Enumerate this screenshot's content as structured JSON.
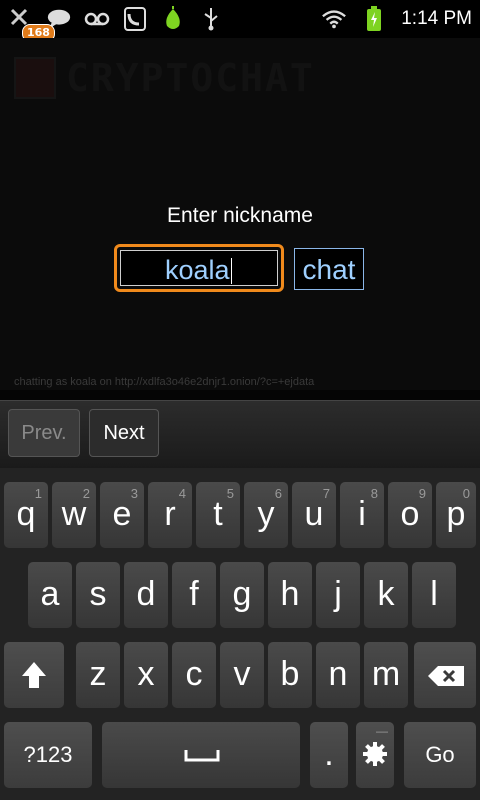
{
  "status_bar": {
    "notification_count": "168",
    "time": "1:14 PM",
    "icons": [
      "missed-call-icon",
      "chat-bubble-icon",
      "voicemail-icon",
      "sip-phone-icon",
      "tor-onion-icon",
      "usb-icon",
      "wifi-icon",
      "battery-charging-icon"
    ]
  },
  "webview": {
    "logo_text": "CRYPTOCHAT",
    "prompt": "Enter nickname",
    "nickname_value": "koala",
    "chat_button": "chat",
    "footer_text": "chatting as koala on http://xdlfa3o46e2dnjr1.onion/?c=+ejdata"
  },
  "form_nav": {
    "prev_label": "Prev.",
    "next_label": "Next"
  },
  "keyboard": {
    "row1": [
      {
        "k": "q",
        "alt": "1"
      },
      {
        "k": "w",
        "alt": "2"
      },
      {
        "k": "e",
        "alt": "3"
      },
      {
        "k": "r",
        "alt": "4"
      },
      {
        "k": "t",
        "alt": "5"
      },
      {
        "k": "y",
        "alt": "6"
      },
      {
        "k": "u",
        "alt": "7"
      },
      {
        "k": "i",
        "alt": "8"
      },
      {
        "k": "o",
        "alt": "9"
      },
      {
        "k": "p",
        "alt": "0"
      }
    ],
    "row2": [
      "a",
      "s",
      "d",
      "f",
      "g",
      "h",
      "j",
      "k",
      "l"
    ],
    "row3": [
      "z",
      "x",
      "c",
      "v",
      "b",
      "n",
      "m"
    ],
    "symbols_label": "?123",
    "period_label": ".",
    "go_label": "Go",
    "shift_icon": "shift-up-arrow-icon",
    "delete_icon": "backspace-icon",
    "space_icon": "space-bar-icon",
    "settings_icon": "gear-icon"
  }
}
